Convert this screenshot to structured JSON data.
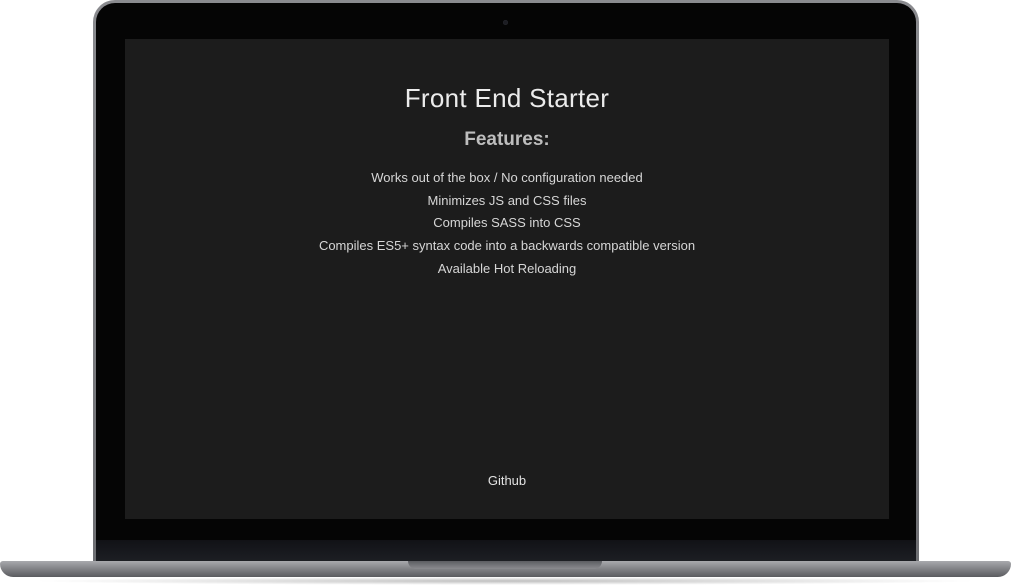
{
  "page": {
    "title": "Front End Starter",
    "features_heading": "Features:",
    "features": [
      "Works out of the box / No configuration needed",
      "Minimizes JS and CSS files",
      "Compiles SASS into CSS",
      "Compiles ES5+ syntax code into a backwards compatible version",
      "Available Hot Reloading"
    ],
    "footer_link": "Github"
  },
  "colors": {
    "screen_background": "#1c1c1c",
    "text": "#e4e4e4",
    "heading": "#bdbdbd",
    "device_frame": "#6e6f73"
  }
}
